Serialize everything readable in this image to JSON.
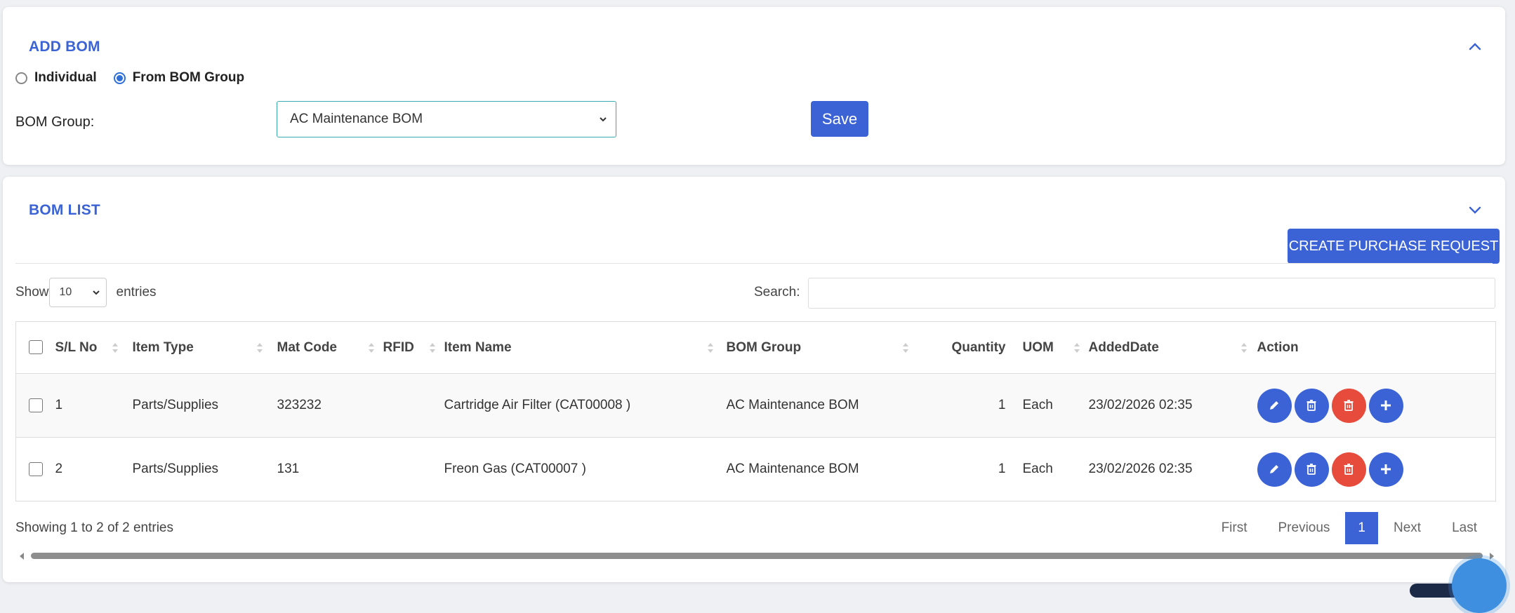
{
  "add_bom": {
    "title": "ADD BOM",
    "radio_individual": "Individual",
    "radio_group": "From BOM Group",
    "bom_group_label": "BOM Group:",
    "bom_group_value": "AC Maintenance BOM",
    "save_label": "Save"
  },
  "bom_list": {
    "title": "BOM LIST",
    "create_pr_label": "CREATE PURCHASE REQUEST",
    "show_label": "Show",
    "entries_value": "10",
    "entries_label": "entries",
    "search_label": "Search:",
    "search_value": "",
    "columns": [
      "S/L No",
      "Item Type",
      "Mat Code",
      "RFID",
      "Item Name",
      "BOM Group",
      "Quantity",
      "UOM",
      "AddedDate",
      "Action"
    ],
    "rows": [
      {
        "sl": "1",
        "item_type": "Parts/Supplies",
        "mat_code": "323232",
        "rfid": "",
        "item_name": "Cartridge Air Filter (CAT00008 )",
        "bom_group": "AC Maintenance BOM",
        "quantity": "1",
        "uom": "Each",
        "added_date": "23/02/2026 02:35"
      },
      {
        "sl": "2",
        "item_type": "Parts/Supplies",
        "mat_code": "131",
        "rfid": "",
        "item_name": "Freon Gas (CAT00007 )",
        "bom_group": "AC Maintenance BOM",
        "quantity": "1",
        "uom": "Each",
        "added_date": "23/02/2026 02:35"
      }
    ],
    "info": "Showing 1 to 2 of 2 entries",
    "pager": {
      "first": "First",
      "previous": "Previous",
      "current": "1",
      "next": "Next",
      "last": "Last"
    }
  },
  "colors": {
    "accent": "#3b63d6",
    "danger": "#e74b3c",
    "select_border": "#3aa9b0"
  },
  "icons": [
    "chevron-up-icon",
    "chevron-down-icon",
    "edit-icon",
    "trash-icon",
    "delete-icon",
    "plus-icon",
    "chat-icon"
  ]
}
